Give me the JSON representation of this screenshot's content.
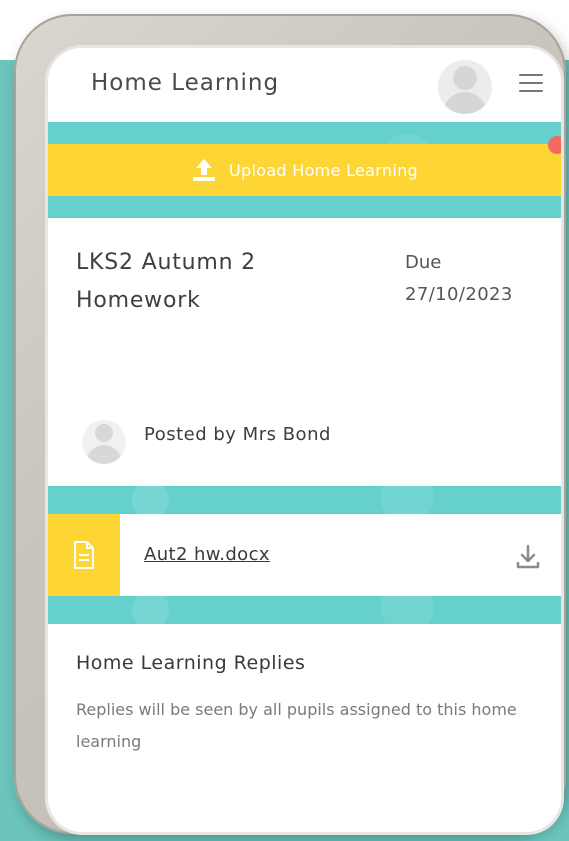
{
  "header": {
    "title": "Home Learning",
    "menu_icon": "hamburger-menu-icon",
    "avatar_icon": "user-avatar-icon"
  },
  "upload": {
    "label": "Upload Home Learning",
    "icon": "upload-icon"
  },
  "homework": {
    "title": "LKS2 Autumn 2 Homework",
    "due_label": "Due",
    "due_date": "27/10/2023"
  },
  "post": {
    "posted_by": "Posted by Mrs Bond"
  },
  "attachment": {
    "file_name": "Aut2 hw.docx",
    "file_icon": "document-icon",
    "download_icon": "download-icon"
  },
  "replies": {
    "heading": "Home Learning Replies",
    "description": "Replies will be seen by all pupils assigned to this home learning"
  },
  "colors": {
    "teal": "#66d1cc",
    "yellow": "#fdd535",
    "text": "#3f3f3f",
    "muted": "#7a7a7a"
  }
}
